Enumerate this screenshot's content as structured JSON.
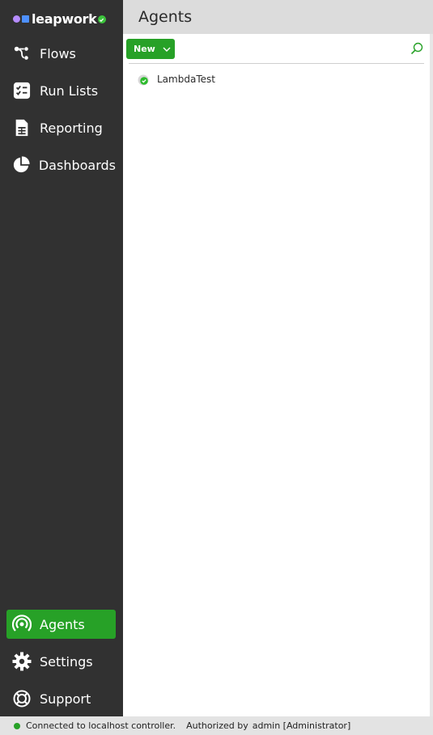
{
  "app": {
    "logo_text": "leapwork"
  },
  "colors": {
    "sidebar_bg": "#313131",
    "accent_green": "#27a127",
    "header_bg": "#dcdcdc",
    "panel_bg": "#ffffff",
    "statusbar_bg": "#e3e3e3"
  },
  "sidebar": {
    "top_items": [
      {
        "label": "Flows",
        "icon": "flows-icon"
      },
      {
        "label": "Run Lists",
        "icon": "run-lists-icon"
      },
      {
        "label": "Reporting",
        "icon": "reporting-icon"
      },
      {
        "label": "Dashboards",
        "icon": "dashboards-icon"
      }
    ],
    "bottom_items": [
      {
        "label": "Agents",
        "icon": "agents-icon",
        "active": true
      },
      {
        "label": "Settings",
        "icon": "settings-icon"
      },
      {
        "label": "Support",
        "icon": "support-icon"
      }
    ]
  },
  "header": {
    "title": "Agents"
  },
  "toolbar": {
    "new_label": "New",
    "new_icon": "chevron-down-icon",
    "search_icon": "search-icon"
  },
  "agents": [
    {
      "name": "LambdaTest",
      "status": "connected"
    }
  ],
  "statusbar": {
    "connection": "Connected to localhost controller.",
    "authorized_label": "Authorized by",
    "user": "admin [Administrator]"
  }
}
